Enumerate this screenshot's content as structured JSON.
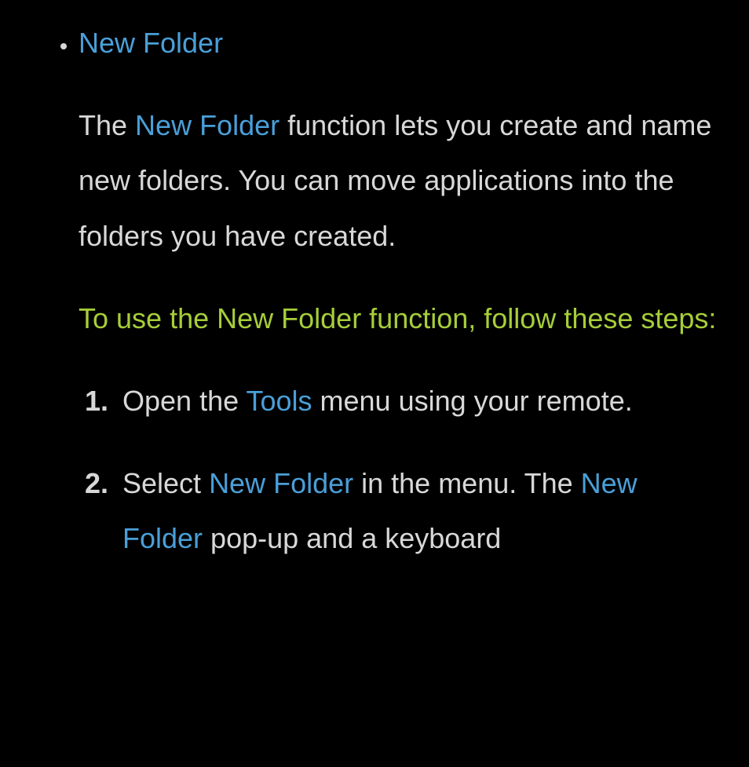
{
  "section": {
    "title": "New Folder",
    "desc_pre": "The ",
    "desc_keyword": "New Folder",
    "desc_post": " function lets you create and name new folders. You can move applications into the folders you have created.",
    "subheading": "To use the New Folder function, follow these steps:",
    "steps": [
      {
        "pre": "Open the ",
        "kw1": "Tools",
        "mid": " menu using your remote.",
        "kw2": "",
        "post": ""
      },
      {
        "pre": "Select ",
        "kw1": "New Folder",
        "mid": " in the menu. The ",
        "kw2": "New Folder",
        "post": " pop-up and a keyboard"
      }
    ]
  }
}
